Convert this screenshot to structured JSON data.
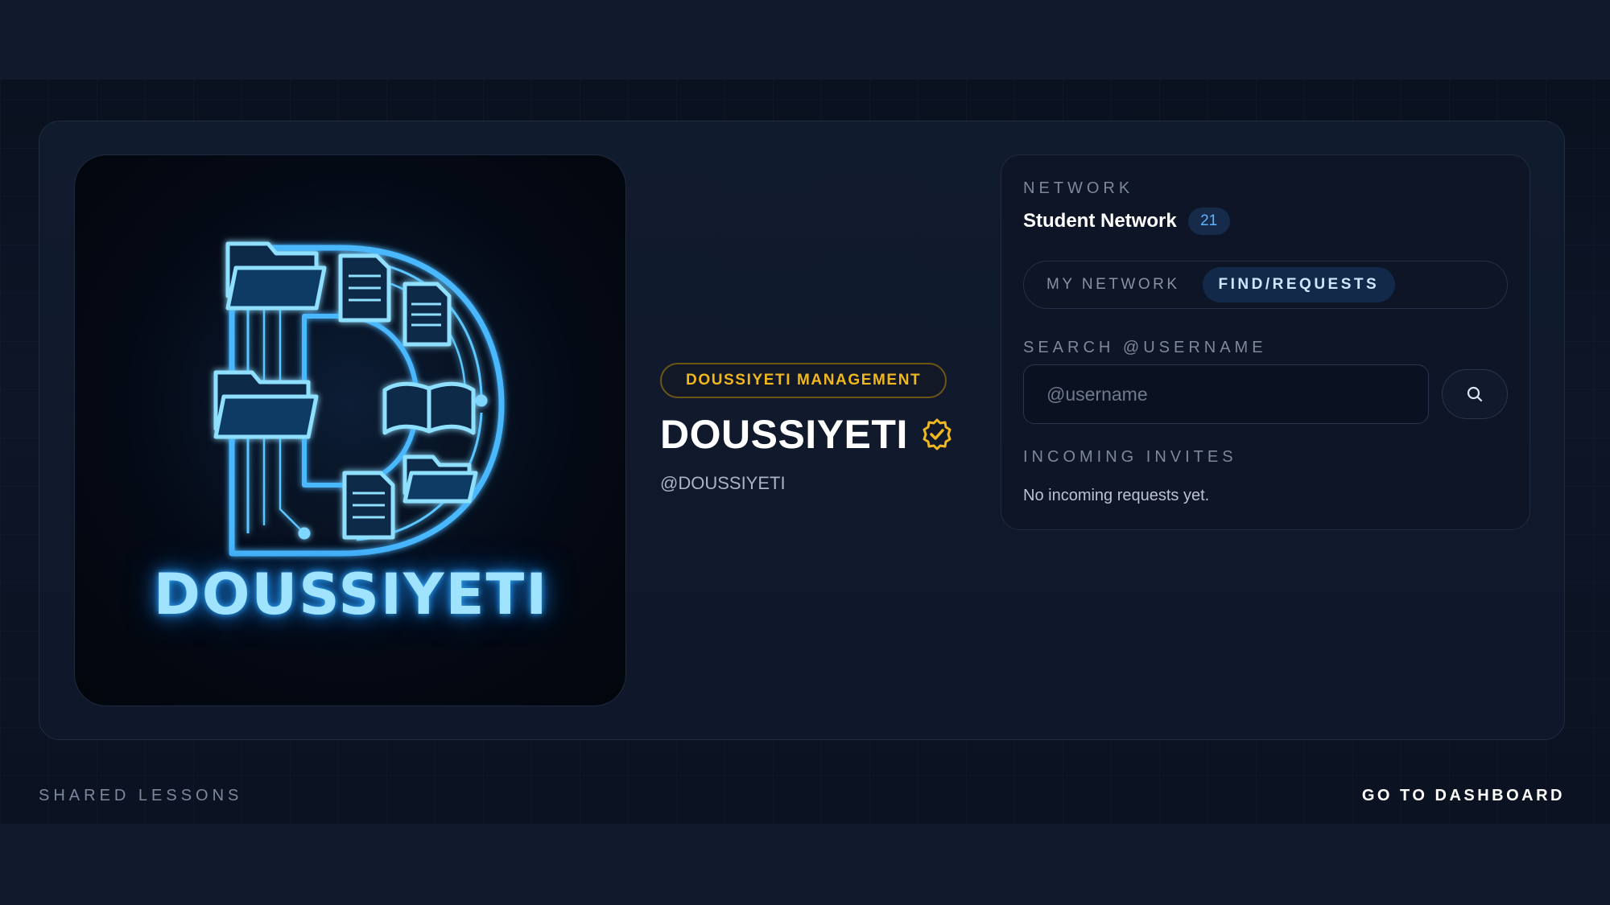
{
  "profile": {
    "logo_text": "DOUSSIYETI",
    "role_badge": "DOUSSIYETI MANAGEMENT",
    "display_name": "DOUSSIYETI",
    "handle": "@DOUSSIYETI",
    "verified_icon": "verified-check-icon"
  },
  "network": {
    "section_label": "NETWORK",
    "title": "Student Network",
    "count": "21",
    "tabs": [
      {
        "label": "MY NETWORK",
        "active": false
      },
      {
        "label": "FIND/REQUESTS",
        "active": true
      }
    ],
    "search_label": "SEARCH @USERNAME",
    "search_placeholder": "@username",
    "search_value": "",
    "search_icon": "search-icon",
    "invites_label": "INCOMING INVITES",
    "invites_empty": "No incoming requests yet."
  },
  "footer": {
    "left_label": "SHARED LESSONS",
    "dashboard_link": "GO TO DASHBOARD"
  },
  "colors": {
    "accent_gold": "#f0b81e",
    "accent_blue": "#5fb4ff",
    "background": "#111a2c"
  }
}
